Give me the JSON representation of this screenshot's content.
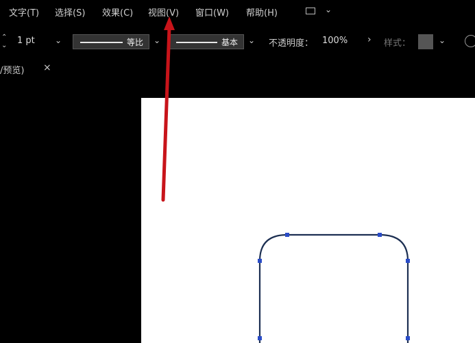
{
  "menu": {
    "items": [
      "文字(T)",
      "选择(S)",
      "效果(C)",
      "视图(V)",
      "窗口(W)",
      "帮助(H)"
    ]
  },
  "control_bar": {
    "stroke_weight": "1 pt",
    "variable_profile_label": "等比",
    "brush_label": "基本",
    "opacity_label": "不透明度：",
    "opacity_value": "100%",
    "style_label": "样式："
  },
  "document_tab": {
    "label": "/预览)"
  },
  "colors": {
    "annotation_arrow": "#c8141a",
    "path_stroke": "#1c2f52",
    "anchor_point": "#2a4cc8",
    "artboard": "#ffffff",
    "workspace": "#000000"
  }
}
